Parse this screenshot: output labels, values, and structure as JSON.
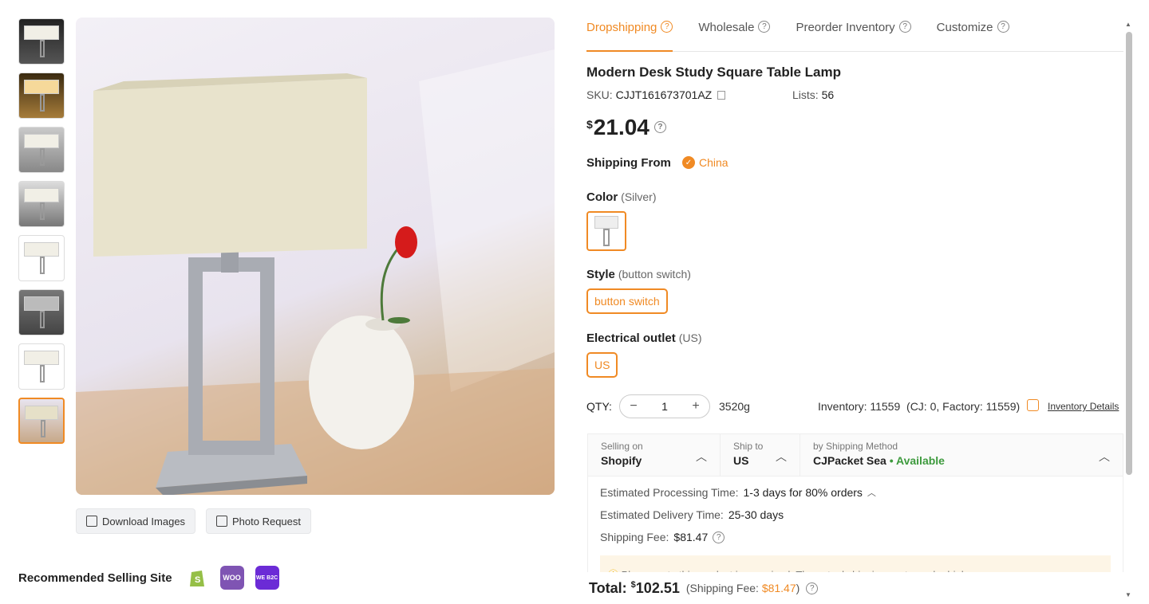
{
  "gallery": {
    "thumbnail_count": 8,
    "active_index": 7,
    "download_label": "Download Images",
    "photo_request_label": "Photo Request"
  },
  "recommended": {
    "label": "Recommended Selling Site",
    "sites": [
      "shopify-icon",
      "woocommerce-icon",
      "wepo-icon"
    ],
    "woo_text": "WOO",
    "wepo_text": "WE B2C"
  },
  "tabs": [
    {
      "label": "Dropshipping",
      "active": true
    },
    {
      "label": "Wholesale",
      "active": false
    },
    {
      "label": "Preorder Inventory",
      "active": false
    },
    {
      "label": "Customize",
      "active": false
    }
  ],
  "product": {
    "title": "Modern Desk Study Square Table Lamp",
    "sku_label": "SKU:",
    "sku": "CJJT161673701AZ",
    "lists_label": "Lists:",
    "lists": "56",
    "currency": "$",
    "price": "21.04"
  },
  "shipping_from": {
    "label": "Shipping From",
    "value": "China"
  },
  "color": {
    "label": "Color",
    "selected": "(Silver)"
  },
  "style": {
    "label": "Style",
    "selected": "(button switch)",
    "option": "button switch"
  },
  "outlet": {
    "label": "Electrical outlet",
    "selected": "(US)",
    "option": "US"
  },
  "quantity": {
    "label": "QTY:",
    "value": "1",
    "minus": "−",
    "plus": "+",
    "weight": "3520g"
  },
  "inventory": {
    "text": "Inventory: 11559  (CJ: 0, Factory: 11559)",
    "details_link": "Inventory Details"
  },
  "shipping": {
    "selling_on_label": "Selling on",
    "selling_on": "Shopify",
    "ship_to_label": "Ship to",
    "ship_to": "US",
    "method_label": "by Shipping Method",
    "method": "CJPacket Sea",
    "availability": "• Available",
    "processing_label": "Estimated Processing Time:",
    "processing": "1-3 days for 80% orders",
    "delivery_label": "Estimated Delivery Time:",
    "delivery": "25-30 days",
    "fee_label": "Shipping Fee:",
    "fee": "$81.47",
    "notice": "Please note this product is oversized. The actual shipping cost may be higher."
  },
  "total": {
    "label": "Total:",
    "currency": "$",
    "amount": "102.51",
    "fee_prefix": "(Shipping Fee:",
    "fee": "$81.47",
    "fee_suffix": ")"
  },
  "colors": {
    "accent": "#f08a24",
    "available": "#3d9a3d"
  }
}
